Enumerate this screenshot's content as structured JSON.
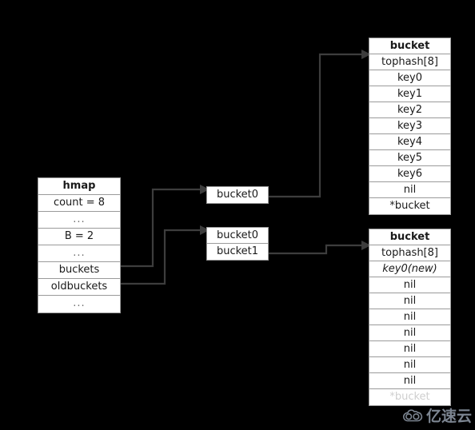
{
  "diagram": {
    "title": "go map hmap buckets oldbuckets structure",
    "background_color": "#000000",
    "box_fill": "#ffffff",
    "line_color": "#3d3d3d"
  },
  "hmap": {
    "header": "hmap",
    "rows": [
      "count = 8",
      "...",
      "B = 2",
      "...",
      "buckets",
      "oldbuckets",
      "..."
    ]
  },
  "new_bucket_list": {
    "rows": [
      "bucket0"
    ]
  },
  "old_bucket_list": {
    "rows": [
      "bucket0",
      "bucket1"
    ]
  },
  "bucket_top": {
    "header": "bucket",
    "rows": [
      "tophash[8]",
      "key0",
      "key1",
      "key2",
      "key3",
      "key4",
      "key5",
      "key6",
      "nil",
      "*bucket"
    ]
  },
  "bucket_bottom": {
    "header": "bucket",
    "rows": [
      "tophash[8]",
      "key0(new)",
      "nil",
      "nil",
      "nil",
      "nil",
      "nil",
      "nil",
      "nil",
      "*bucket"
    ]
  },
  "watermark": {
    "icon": "cloud-icon",
    "text": "亿速云"
  }
}
